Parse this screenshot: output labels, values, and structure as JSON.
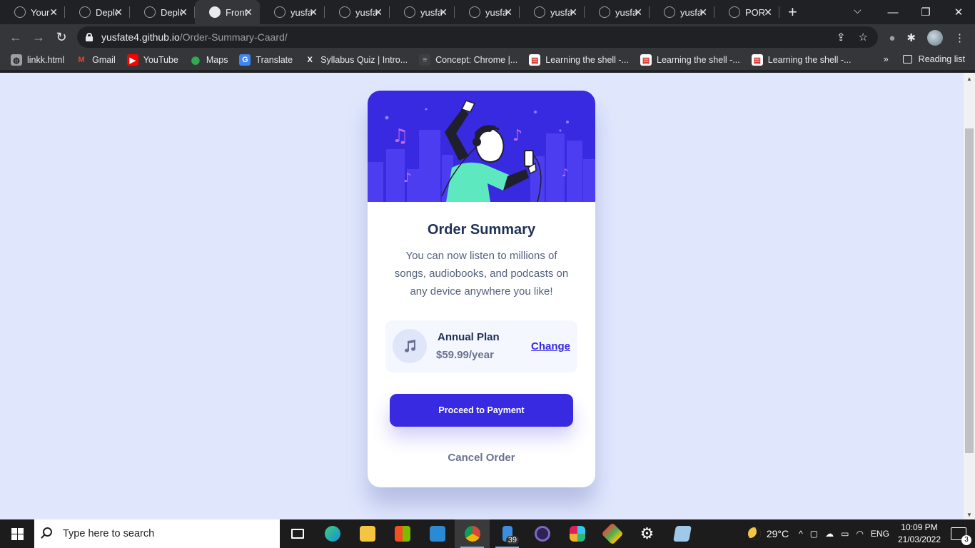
{
  "browser": {
    "tabs": [
      {
        "title": "Your",
        "active": false
      },
      {
        "title": "Deplo",
        "active": false
      },
      {
        "title": "Deplo",
        "active": false
      },
      {
        "title": "Front",
        "active": true
      },
      {
        "title": "yusfa",
        "active": false
      },
      {
        "title": "yusfa",
        "active": false
      },
      {
        "title": "yusfa",
        "active": false
      },
      {
        "title": "yusfa",
        "active": false
      },
      {
        "title": "yusfa",
        "active": false
      },
      {
        "title": "yusfa",
        "active": false
      },
      {
        "title": "yusfa",
        "active": false
      },
      {
        "title": "PORT",
        "active": false
      }
    ],
    "address": {
      "host": "yusfate4.github.io",
      "path": "/Order-Summary-Caard/"
    },
    "bookmarks": [
      {
        "label": "linkk.html",
        "icon": "globe-icon"
      },
      {
        "label": "Gmail",
        "icon": "gmail-icon"
      },
      {
        "label": "YouTube",
        "icon": "youtube-icon"
      },
      {
        "label": "Maps",
        "icon": "maps-icon"
      },
      {
        "label": "Translate",
        "icon": "translate-icon"
      },
      {
        "label": "Syllabus Quiz | Intro...",
        "icon": "x-icon"
      },
      {
        "label": "Concept: Chrome |...",
        "icon": "page-icon"
      },
      {
        "label": "Learning the shell -...",
        "icon": "doc-icon"
      },
      {
        "label": "Learning the shell -...",
        "icon": "doc-icon"
      },
      {
        "label": "Learning the shell -...",
        "icon": "doc-icon"
      }
    ],
    "reading_list_label": "Reading list",
    "more_bookmarks_label": "»"
  },
  "card": {
    "title": "Order Summary",
    "description": "You can now listen to millions of songs, audiobooks, and podcasts on any device anywhere you like!",
    "plan": {
      "name": "Annual Plan",
      "price": "$59.99/year",
      "change_label": "Change"
    },
    "pay_label": "Proceed to Payment",
    "cancel_label": "Cancel Order",
    "colors": {
      "background": "#e0e7fd",
      "primary": "#382ae1",
      "title": "#1f2f56",
      "text": "#56627e",
      "muted": "#6a7190",
      "hero": "#382ae1"
    }
  },
  "taskbar": {
    "search_placeholder": "Type here to search",
    "explorer_badge": "39",
    "weather": "29°C",
    "language": "ENG",
    "time": "10:09 PM",
    "date": "21/03/2022",
    "notifications": "3"
  }
}
